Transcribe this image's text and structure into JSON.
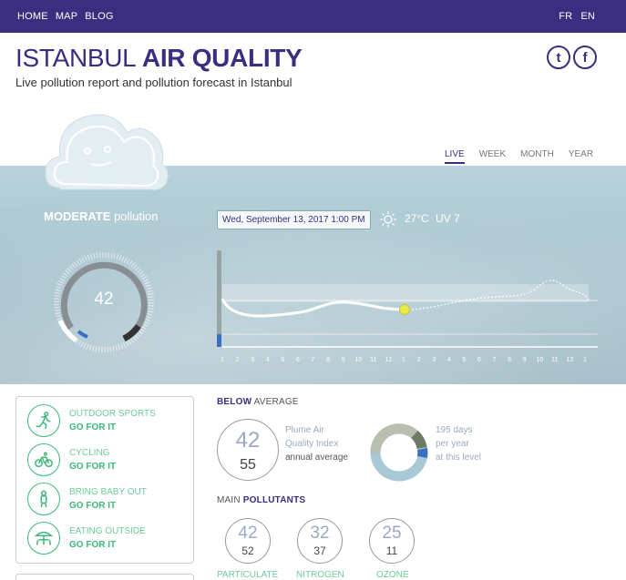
{
  "nav": {
    "home": "HOME",
    "map": "MAP",
    "blog": "BLOG",
    "fr": "FR",
    "en": "EN"
  },
  "header": {
    "title_city": "ISTANBUL",
    "title_rest": "AIR QUALITY",
    "subtitle": "Live pollution report and pollution forecast in Istanbul"
  },
  "social": {
    "twitter_icon": "twitter-icon",
    "facebook_icon": "facebook-icon",
    "twitter_glyph": "t",
    "facebook_glyph": "f"
  },
  "tabs": {
    "live": "LIVE",
    "week": "WEEK",
    "month": "MONTH",
    "year": "YEAR"
  },
  "status": {
    "level": "MODERATE",
    "suffix": "pollution",
    "value": "42"
  },
  "weather": {
    "datetime": "Wed, September 13, 2017 1:00 PM",
    "temperature": "27°C",
    "uv": "UV 7",
    "icon": "sun-icon"
  },
  "timeline": {
    "hours": [
      "1",
      "2",
      "3",
      "4",
      "5",
      "6",
      "7",
      "8",
      "9",
      "10",
      "11",
      "12",
      "1",
      "2",
      "3",
      "4",
      "5",
      "6",
      "7",
      "8",
      "9",
      "10",
      "11",
      "12",
      "1"
    ]
  },
  "activities": [
    {
      "name": "OUTDOOR SPORTS",
      "advice": "GO FOR IT",
      "icon": "running-icon"
    },
    {
      "name": "CYCLING",
      "advice": "GO FOR IT",
      "icon": "bicycle-icon"
    },
    {
      "name": "BRING BABY OUT",
      "advice": "GO FOR IT",
      "icon": "baby-icon"
    },
    {
      "name": "EATING OUTSIDE",
      "advice": "GO FOR IT",
      "icon": "umbrella-table-icon"
    }
  ],
  "summary": {
    "label_bold": "BELOW",
    "label_rest": "AVERAGE",
    "current": "42",
    "average": "55",
    "index_line1": "Plume Air",
    "index_line2": "Quality Index",
    "index_line3": "annual average",
    "days_line1": "195 days",
    "days_line2": "per year",
    "days_line3": "at this level"
  },
  "pollutants_header": {
    "prefix": "MAIN",
    "bold": "POLLUTANTS"
  },
  "pollutants": [
    {
      "current": "42",
      "average": "52",
      "name": "PARTICULATE"
    },
    {
      "current": "32",
      "average": "37",
      "name": "NITROGEN"
    },
    {
      "current": "25",
      "average": "11",
      "name": "OZONE"
    }
  ],
  "colors": {
    "brand": "#3b2d80",
    "green": "#3cb878",
    "muted_blue": "#9aa9c4",
    "forecast_dot": "#e8e84a"
  }
}
